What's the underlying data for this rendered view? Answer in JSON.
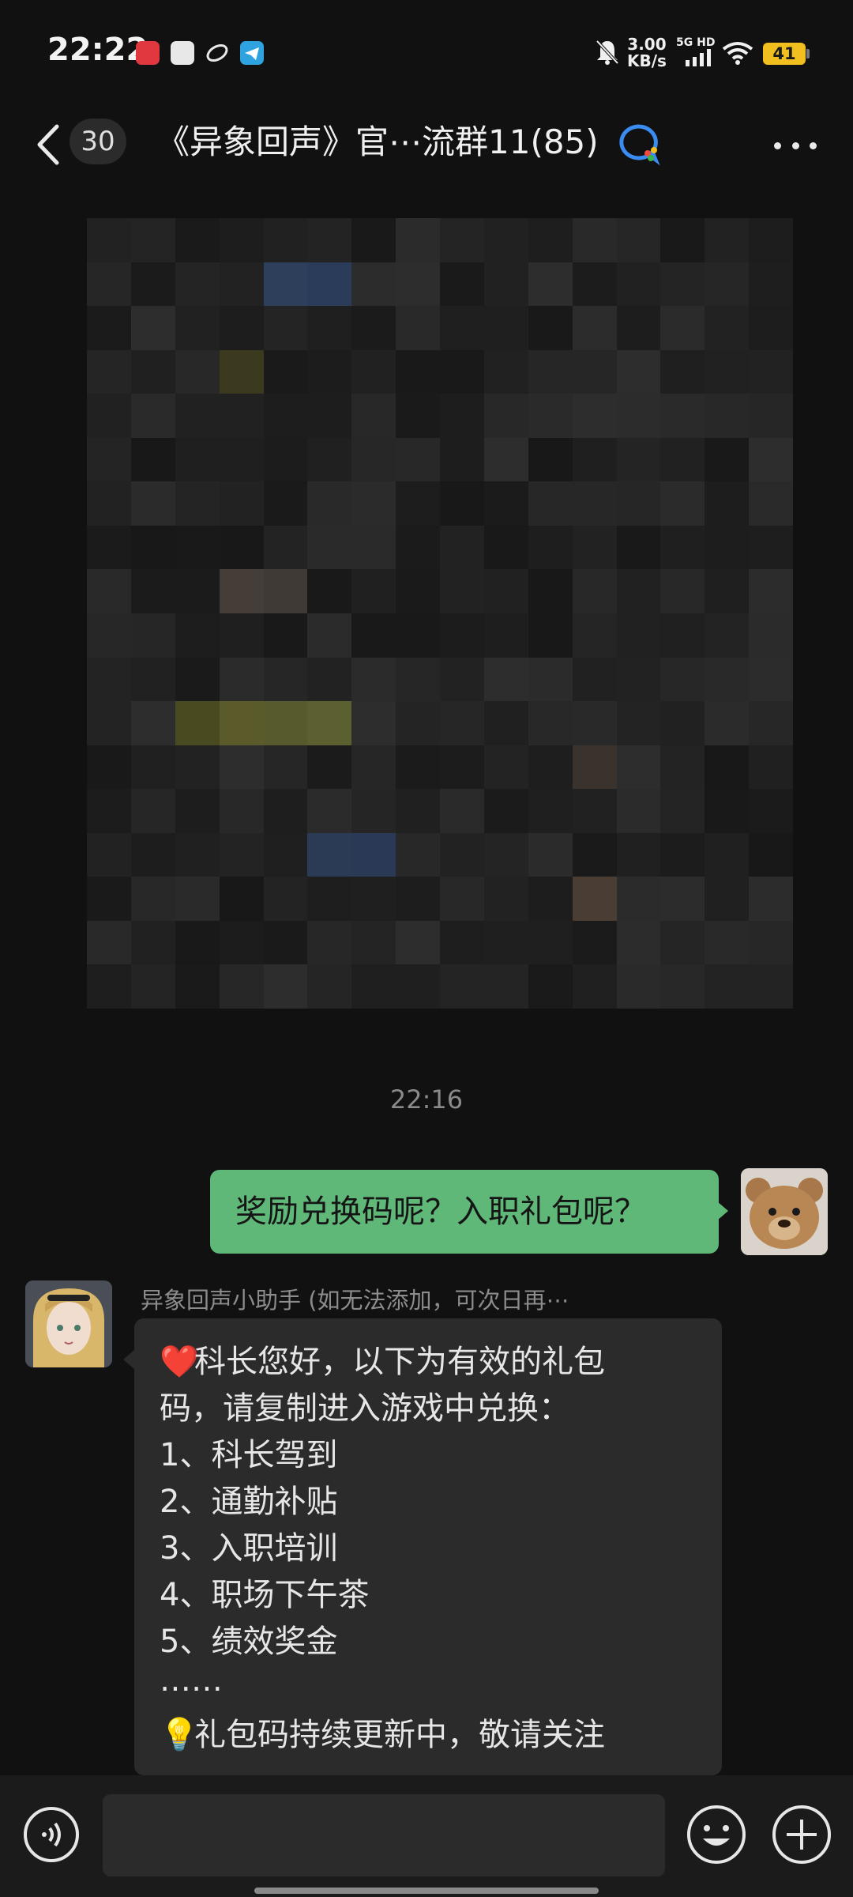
{
  "status_bar": {
    "time": "22:22",
    "net_speed_value": "3.00",
    "net_speed_unit": "KB/s",
    "network_type": "5G HD",
    "battery": "41",
    "app_icons": [
      "xiaohongshu-icon",
      "notes-app-icon",
      "app-icon",
      "telegram-icon"
    ],
    "status_icons": [
      "mute-bell-icon",
      "signal-icon",
      "wifi-icon",
      "battery-icon"
    ]
  },
  "header": {
    "unread_count": "30",
    "title": "《异象回声》官⋯流群11(85)",
    "icons": [
      "back-icon",
      "group-chat-icon",
      "more-icon"
    ]
  },
  "messages": {
    "image_message": {
      "description_icon": "pixelated-image"
    },
    "timestamp": "22:16",
    "self_text": "奖励兑换码呢？入职礼包呢？",
    "bot_sender": "异象回声小助手 (如无法添加，可次日再⋯",
    "bot_lines": {
      "l1": "科长您好，以下为有效的礼包",
      "l2": "码，请复制进入游戏中兑换：",
      "l3": "1、科长驾到",
      "l4": "2、通勤补贴",
      "l5": "3、入职培训",
      "l6": "4、职场下午茶",
      "l7": "5、绩效奖金",
      "l8": "⋯⋯",
      "l9": "礼包码持续更新中，敬请关注"
    },
    "bot_emojis": {
      "heart": "❤️",
      "bulb": "💡"
    }
  },
  "input_bar": {
    "placeholder": "",
    "icons": [
      "voice-icon",
      "emoji-icon",
      "plus-icon"
    ]
  },
  "colors": {
    "background": "#111111",
    "self_bubble": "#5fb878",
    "bot_bubble": "#2b2b2b",
    "battery": "#f2c01e"
  }
}
